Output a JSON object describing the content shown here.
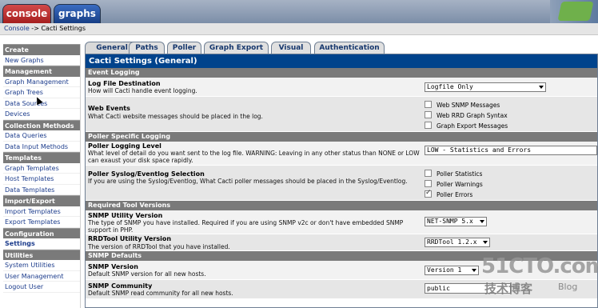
{
  "top_tabs": {
    "console": "console",
    "graphs": "graphs"
  },
  "breadcrumb": {
    "link": "Console",
    "separator": " -> ",
    "current": "Cacti Settings"
  },
  "sidebar": [
    {
      "type": "head",
      "label": "Create"
    },
    {
      "type": "item",
      "label": "New Graphs"
    },
    {
      "type": "head",
      "label": "Management"
    },
    {
      "type": "item",
      "label": "Graph Management"
    },
    {
      "type": "item",
      "label": "Graph Trees"
    },
    {
      "type": "item",
      "label": "Data Sources"
    },
    {
      "type": "item",
      "label": "Devices"
    },
    {
      "type": "head",
      "label": "Collection Methods"
    },
    {
      "type": "item",
      "label": "Data Queries"
    },
    {
      "type": "item",
      "label": "Data Input Methods"
    },
    {
      "type": "head",
      "label": "Templates"
    },
    {
      "type": "item",
      "label": "Graph Templates"
    },
    {
      "type": "item",
      "label": "Host Templates"
    },
    {
      "type": "item",
      "label": "Data Templates"
    },
    {
      "type": "head",
      "label": "Import/Export"
    },
    {
      "type": "item",
      "label": "Import Templates"
    },
    {
      "type": "item",
      "label": "Export Templates"
    },
    {
      "type": "head",
      "label": "Configuration"
    },
    {
      "type": "item",
      "label": "Settings",
      "active": true
    },
    {
      "type": "head",
      "label": "Utilities"
    },
    {
      "type": "item",
      "label": "System Utilities"
    },
    {
      "type": "item",
      "label": "User Management"
    },
    {
      "type": "item",
      "label": "Logout User"
    }
  ],
  "tabs": [
    "General",
    "Paths",
    "Poller",
    "Graph Export",
    "Visual",
    "Authentication"
  ],
  "main": {
    "title": "Cacti Settings (General)",
    "sections": {
      "event_logging": "Event Logging",
      "poller_logging": "Poller Specific Logging",
      "required_tools": "Required Tool Versions",
      "snmp_defaults": "SNMP Defaults"
    },
    "log_file_destination": {
      "label": "Log File Destination",
      "desc": "How will Cacti handle event logging.",
      "value": "Logfile Only"
    },
    "web_events": {
      "label": "Web Events",
      "desc": "What Cacti website messages should be placed in the log.",
      "options": [
        {
          "label": "Web SNMP Messages",
          "checked": false
        },
        {
          "label": "Web RRD Graph Syntax",
          "checked": false
        },
        {
          "label": "Graph Export Messages",
          "checked": false
        }
      ]
    },
    "poller_logging_level": {
      "label": "Poller Logging Level",
      "desc": "What level of detail do you want sent to the log file. WARNING: Leaving in any other status than NONE or LOW can exaust your disk space rapidly.",
      "value": "LOW - Statistics and Errors"
    },
    "poller_syslog": {
      "label": "Poller Syslog/Eventlog Selection",
      "desc": "If you are using the Syslog/Eventlog, What Cacti poller messages should be placed in the Syslog/Eventlog.",
      "options": [
        {
          "label": "Poller Statistics",
          "checked": false
        },
        {
          "label": "Poller Warnings",
          "checked": false
        },
        {
          "label": "Poller Errors",
          "checked": true
        }
      ]
    },
    "snmp_utility_version": {
      "label": "SNMP Utility Version",
      "desc": "The type of SNMP you have installed. Required if you are using SNMP v2c or don't have embedded SNMP support in PHP.",
      "value": "NET-SNMP 5.x"
    },
    "rrdtool_version": {
      "label": "RRDTool Utility Version",
      "desc": "The version of RRDTool that you have installed.",
      "value": "RRDTool 1.2.x"
    },
    "snmp_version": {
      "label": "SNMP Version",
      "desc": "Default SNMP version for all new hosts.",
      "value": "Version 1"
    },
    "snmp_community": {
      "label": "SNMP Community",
      "desc": "Default SNMP read community for all new hosts.",
      "value": "public"
    }
  },
  "watermark": {
    "main": "51CTO.com",
    "sub": "技术博客",
    "blog": "Blog"
  },
  "colors": {
    "title_bar": "#00438c",
    "section_head": "#7a7a7a",
    "link": "#1c3c8c"
  }
}
